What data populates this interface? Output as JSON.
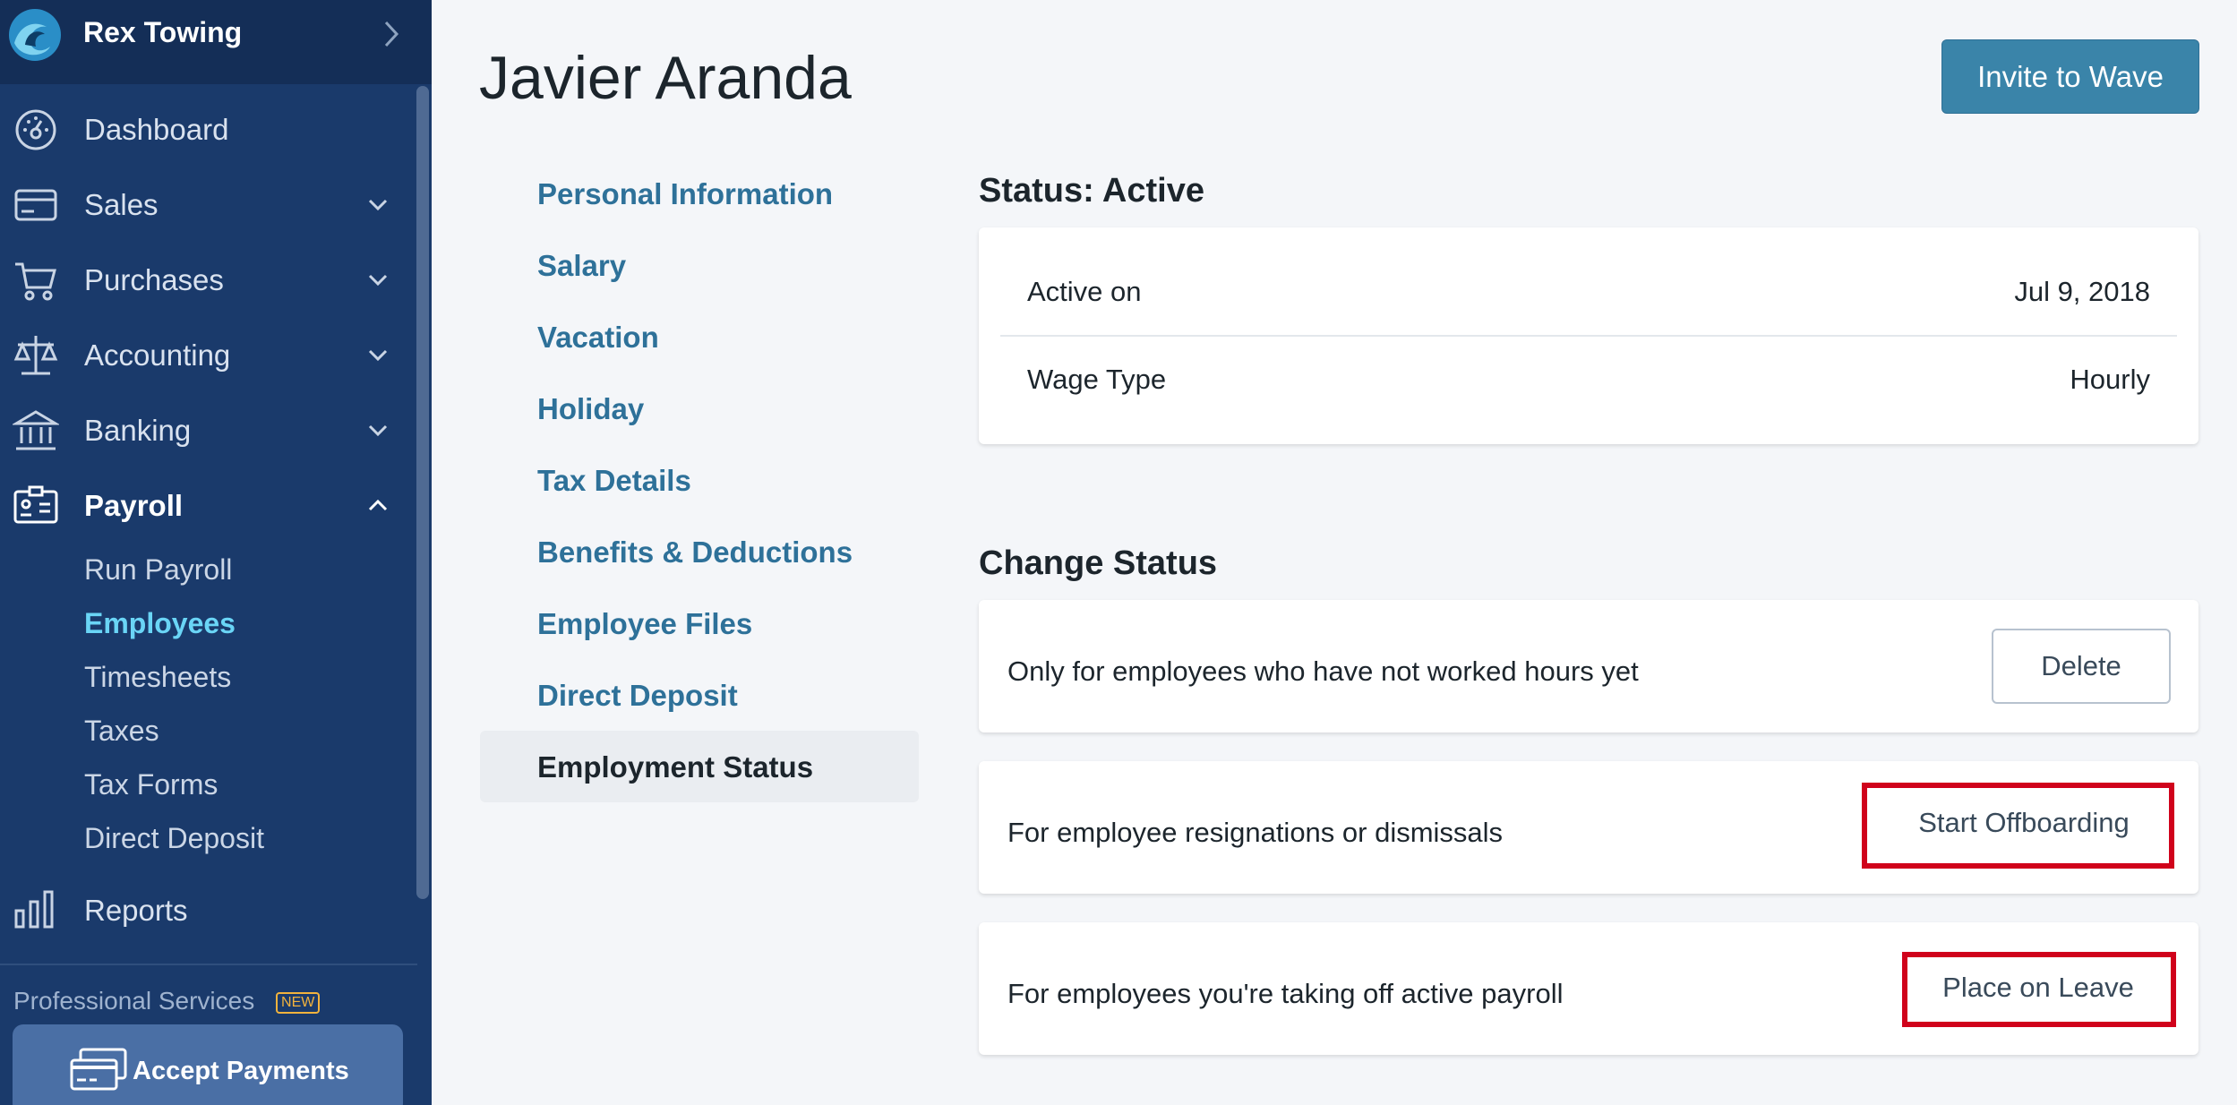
{
  "sidebar": {
    "business_name": "Rex Towing",
    "nav": [
      {
        "label": "Dashboard",
        "icon": "dashboard-icon"
      },
      {
        "label": "Sales",
        "icon": "card-icon"
      },
      {
        "label": "Purchases",
        "icon": "cart-icon"
      },
      {
        "label": "Accounting",
        "icon": "scale-icon"
      },
      {
        "label": "Banking",
        "icon": "bank-icon"
      },
      {
        "label": "Payroll",
        "icon": "id-badge-icon"
      },
      {
        "label": "Reports",
        "icon": "bar-chart-icon"
      }
    ],
    "payroll_sub": [
      "Run Payroll",
      "Employees",
      "Timesheets",
      "Taxes",
      "Tax Forms",
      "Direct Deposit"
    ],
    "promo_label": "Professional Services",
    "promo_badge": "NEW",
    "accept_payments": "Accept Payments"
  },
  "header": {
    "title": "Javier Aranda",
    "invite_button": "Invite to Wave"
  },
  "subnav": [
    "Personal Information",
    "Salary",
    "Vacation",
    "Holiday",
    "Tax Details",
    "Benefits & Deductions",
    "Employee Files",
    "Direct Deposit",
    "Employment Status"
  ],
  "status": {
    "title": "Status: Active",
    "rows": [
      {
        "label": "Active on",
        "value": "Jul 9, 2018"
      },
      {
        "label": "Wage Type",
        "value": "Hourly"
      }
    ]
  },
  "change_status": {
    "title": "Change Status",
    "actions": [
      {
        "description": "Only for employees who have not worked hours yet",
        "button": "Delete"
      },
      {
        "description": "For employee resignations or dismissals",
        "button": "Start Offboarding"
      },
      {
        "description": "For employees you're taking off active payroll",
        "button": "Place on Leave"
      }
    ]
  },
  "colors": {
    "sidebar": "#1a3a6b",
    "accent": "#3a84a9",
    "highlight": "#d0021b"
  }
}
